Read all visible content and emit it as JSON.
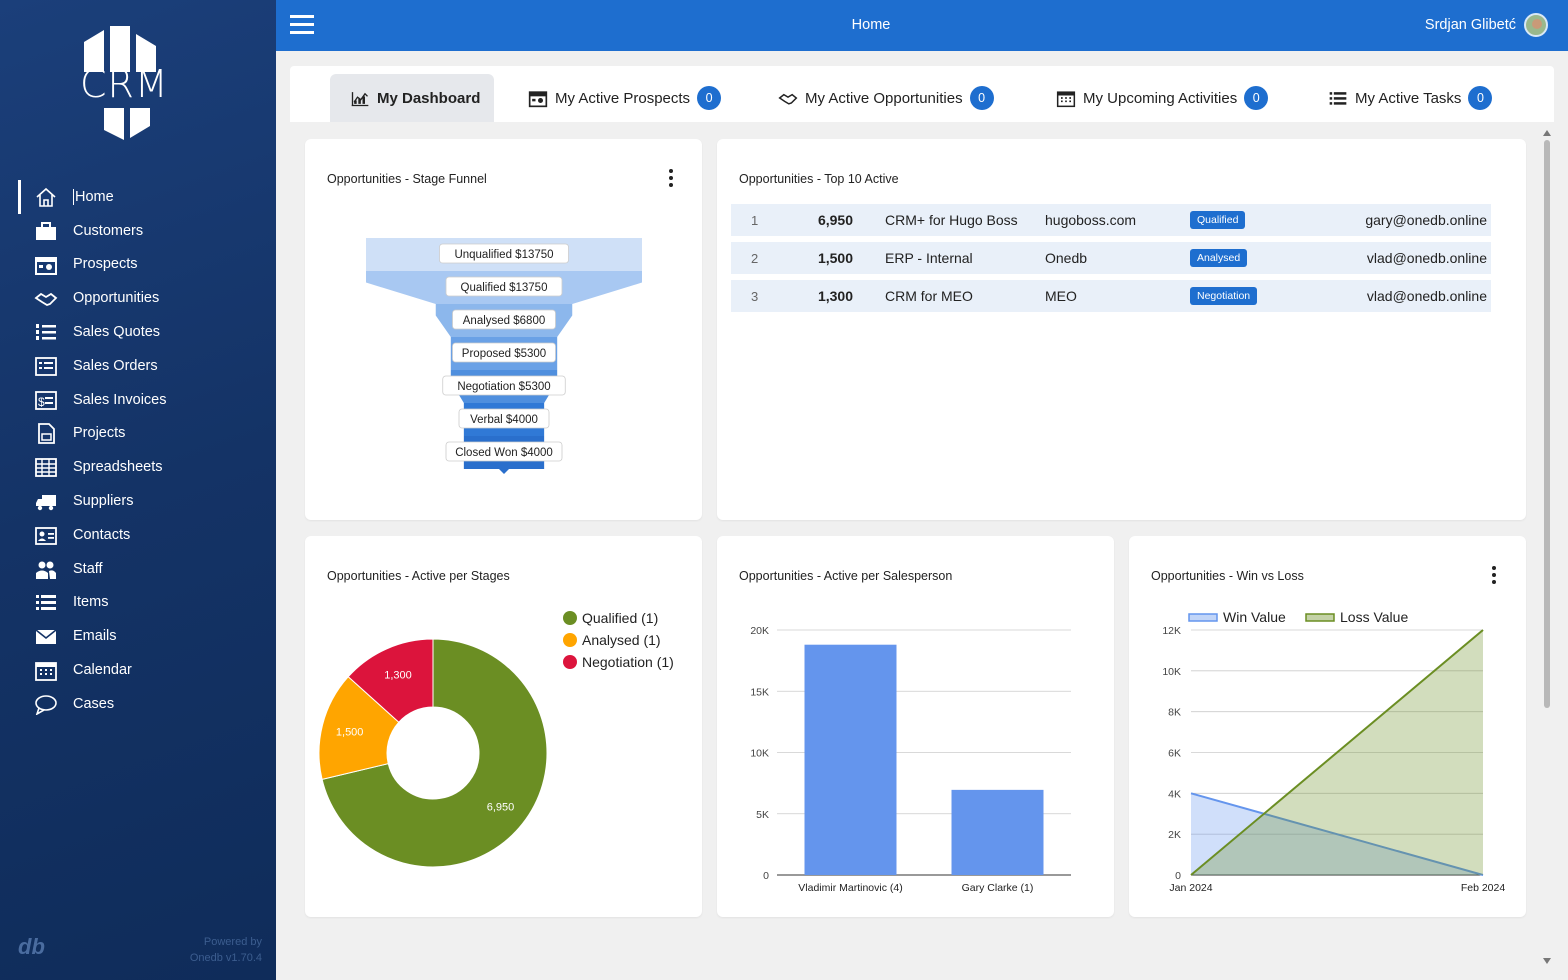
{
  "app": {
    "logo_text": "CRM",
    "top_title": "Home",
    "user_name": "Srdjan Glibetć",
    "powered_by": "Powered by",
    "version": "Onedb v1.70.4"
  },
  "sidebar": {
    "items": [
      {
        "label": "Home",
        "icon": "home-icon",
        "active": true
      },
      {
        "label": "Customers",
        "icon": "briefcase-icon"
      },
      {
        "label": "Prospects",
        "icon": "calendar-person-icon"
      },
      {
        "label": "Opportunities",
        "icon": "handshake-icon"
      },
      {
        "label": "Sales Quotes",
        "icon": "numbered-list-icon"
      },
      {
        "label": "Sales Orders",
        "icon": "order-list-icon"
      },
      {
        "label": "Sales Invoices",
        "icon": "invoice-icon"
      },
      {
        "label": "Projects",
        "icon": "document-icon"
      },
      {
        "label": "Spreadsheets",
        "icon": "table-icon"
      },
      {
        "label": "Suppliers",
        "icon": "truck-icon"
      },
      {
        "label": "Contacts",
        "icon": "contact-card-icon"
      },
      {
        "label": "Staff",
        "icon": "people-icon"
      },
      {
        "label": "Items",
        "icon": "list-icon"
      },
      {
        "label": "Emails",
        "icon": "envelope-icon"
      },
      {
        "label": "Calendar",
        "icon": "calendar-icon"
      },
      {
        "label": "Cases",
        "icon": "speech-bubble-icon"
      }
    ]
  },
  "tabs": [
    {
      "label": "My Dashboard",
      "icon": "dashboard-icon",
      "active": true
    },
    {
      "label": "My Active Prospects",
      "icon": "calendar-person-icon",
      "count": "0"
    },
    {
      "label": "My Active Opportunities",
      "icon": "handshake-icon",
      "count": "0"
    },
    {
      "label": "My Upcoming Activities",
      "icon": "calendar-icon",
      "count": "0"
    },
    {
      "label": "My Active Tasks",
      "icon": "list-icon",
      "count": "0"
    }
  ],
  "cards": {
    "funnel": {
      "title": "Opportunities - Stage Funnel"
    },
    "top10": {
      "title": "Opportunities - Top 10 Active",
      "rows": [
        {
          "rank": "1",
          "value": "6,950",
          "name": "CRM+ for Hugo Boss",
          "company": "hugoboss.com",
          "stage": "Qualified",
          "email": "gary@onedb.online"
        },
        {
          "rank": "2",
          "value": "1,500",
          "name": "ERP - Internal",
          "company": "Onedb",
          "stage": "Analysed",
          "email": "vlad@onedb.online"
        },
        {
          "rank": "3",
          "value": "1,300",
          "name": "CRM for MEO",
          "company": "MEO",
          "stage": "Negotiation",
          "email": "vlad@onedb.online"
        }
      ]
    },
    "stages": {
      "title": "Opportunities - Active per Stages"
    },
    "salesperson": {
      "title": "Opportunities - Active per Salesperson"
    },
    "winloss": {
      "title": "Opportunities - Win vs Loss"
    }
  },
  "chart_data": [
    {
      "type": "funnel",
      "labels": [
        "Unqualified $13750",
        "Qualified $13750",
        "Analysed $6800",
        "Proposed $5300",
        "Negotiation $5300",
        "Verbal $4000",
        "Closed Won $4000"
      ],
      "values": [
        13750,
        13750,
        6800,
        5300,
        5300,
        4000,
        4000
      ],
      "colors": [
        "#cfe0f7",
        "#a8c8f2",
        "#8cb7ec",
        "#6aa1e6",
        "#4f8fde",
        "#3079d6",
        "#2a6fcc"
      ]
    },
    {
      "type": "pie",
      "donut": true,
      "labels": [
        "Qualified (1)",
        "Analysed (1)",
        "Negotiation (1)"
      ],
      "values": [
        6950,
        1500,
        1300
      ],
      "data_labels": [
        "6,950",
        "1,500",
        "1,300"
      ],
      "colors": [
        "#6b8e23",
        "#ffa500",
        "#dc143c"
      ],
      "legend": "right"
    },
    {
      "type": "bar",
      "categories": [
        "Vladimir Martinovic (4)",
        "Gary Clarke (1)"
      ],
      "values": [
        18800,
        6950
      ],
      "ylim": [
        0,
        20000
      ],
      "yticks": [
        "0",
        "5K",
        "10K",
        "15K",
        "20K"
      ],
      "color": "#6495ed",
      "grid": true
    },
    {
      "type": "area",
      "x": [
        "Jan 2024",
        "Feb 2024"
      ],
      "series": [
        {
          "name": "Win Value",
          "values": [
            4000,
            0
          ],
          "color": "#6495ed"
        },
        {
          "name": "Loss Value",
          "values": [
            0,
            12000
          ],
          "color": "#6b8e23"
        }
      ],
      "ylim": [
        0,
        12000
      ],
      "yticks": [
        "0",
        "2K",
        "4K",
        "6K",
        "8K",
        "10K",
        "12K"
      ],
      "legend": "top",
      "grid": true
    }
  ]
}
